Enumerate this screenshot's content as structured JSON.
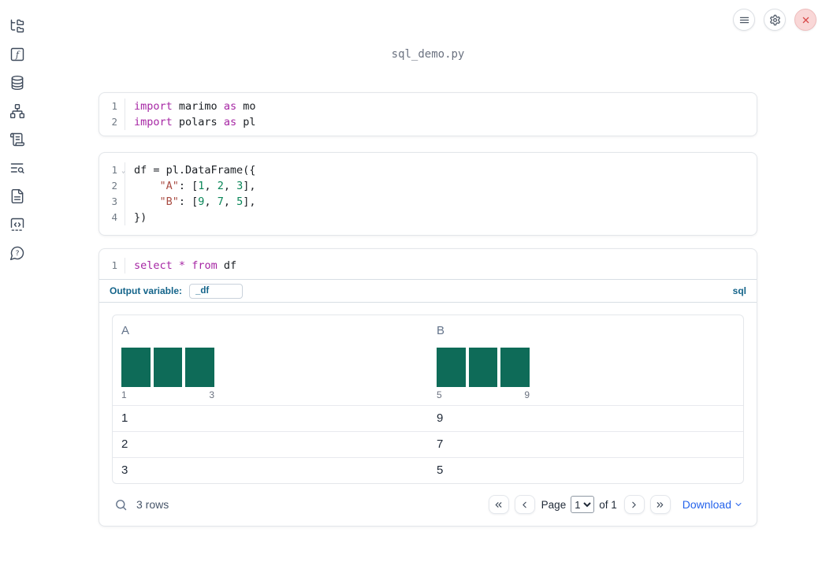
{
  "app": {
    "title": "sql_demo.py"
  },
  "topbar": {
    "menu_button": {
      "icon": "hamburger-menu-icon"
    },
    "settings_button": {
      "icon": "gear-icon"
    },
    "close_button": {
      "icon": "close-icon",
      "bg": "#f9d7d7",
      "fg": "#d84848"
    }
  },
  "sidebar": {
    "items": [
      {
        "id": "file-explorer",
        "icon": "folder-tree-icon"
      },
      {
        "id": "variables",
        "icon": "function-square-icon"
      },
      {
        "id": "data-sources",
        "icon": "database-icon"
      },
      {
        "id": "dependencies",
        "icon": "network-icon"
      },
      {
        "id": "outline",
        "icon": "scroll-icon"
      },
      {
        "id": "logs",
        "icon": "list-search-icon"
      },
      {
        "id": "documentation",
        "icon": "file-text-icon"
      },
      {
        "id": "snippets",
        "icon": "code-square-icon"
      },
      {
        "id": "help",
        "icon": "help-bubble-icon"
      }
    ]
  },
  "colors": {
    "keyword": "#a626a4",
    "string": "#a94d44",
    "number": "#098658",
    "histogram_bar": "#0e6b58",
    "accent_blue": "#14648a",
    "link_blue": "#2563eb"
  },
  "cells": {
    "imports": {
      "lines": [
        {
          "num": "1",
          "tokens": [
            {
              "text": "import"
            },
            {
              "text": " marimo "
            },
            {
              "text": "as"
            },
            {
              "text": " mo"
            }
          ]
        },
        {
          "num": "2",
          "tokens": [
            {
              "text": "import"
            },
            {
              "text": " polars "
            },
            {
              "text": "as"
            },
            {
              "text": " pl"
            }
          ]
        }
      ]
    },
    "dataframe": {
      "fold_indicator": "⌄",
      "lines": [
        {
          "num": "1",
          "tokens": [
            {
              "text": "df = pl.DataFrame({"
            }
          ]
        },
        {
          "num": "2",
          "tokens": [
            {
              "text": "    "
            },
            {
              "text": "\"A\""
            },
            {
              "text": ": ["
            },
            {
              "text": "1"
            },
            {
              "text": ", "
            },
            {
              "text": "2"
            },
            {
              "text": ", "
            },
            {
              "text": "3"
            },
            {
              "text": "],"
            }
          ]
        },
        {
          "num": "3",
          "tokens": [
            {
              "text": "    "
            },
            {
              "text": "\"B\""
            },
            {
              "text": ": ["
            },
            {
              "text": "9"
            },
            {
              "text": ", "
            },
            {
              "text": "7"
            },
            {
              "text": ", "
            },
            {
              "text": "5"
            },
            {
              "text": "],"
            }
          ]
        },
        {
          "num": "4",
          "tokens": [
            {
              "text": "})"
            }
          ]
        }
      ]
    },
    "sql": {
      "lines": [
        {
          "num": "1",
          "tokens": [
            {
              "text": "select"
            },
            {
              "text": " "
            },
            {
              "text": "*"
            },
            {
              "text": " "
            },
            {
              "text": "from"
            },
            {
              "text": " df"
            }
          ]
        }
      ],
      "output_variable_label": "Output variable:",
      "output_variable_value": "_df",
      "language_badge": "sql"
    }
  },
  "table": {
    "columns": [
      {
        "name": "A",
        "histogram": {
          "type": "bar",
          "bin_counts": [
            1,
            1,
            1
          ],
          "min_label": "1",
          "max_label": "3"
        }
      },
      {
        "name": "B",
        "histogram": {
          "type": "bar",
          "bin_counts": [
            1,
            1,
            1
          ],
          "min_label": "5",
          "max_label": "9"
        }
      }
    ],
    "rows": [
      [
        "1",
        "9"
      ],
      [
        "2",
        "7"
      ],
      [
        "3",
        "5"
      ]
    ],
    "footer": {
      "rows_count_label": "3 rows",
      "page_label": "Page",
      "page_value": "1",
      "of_label": "of 1",
      "download_label": "Download"
    }
  }
}
